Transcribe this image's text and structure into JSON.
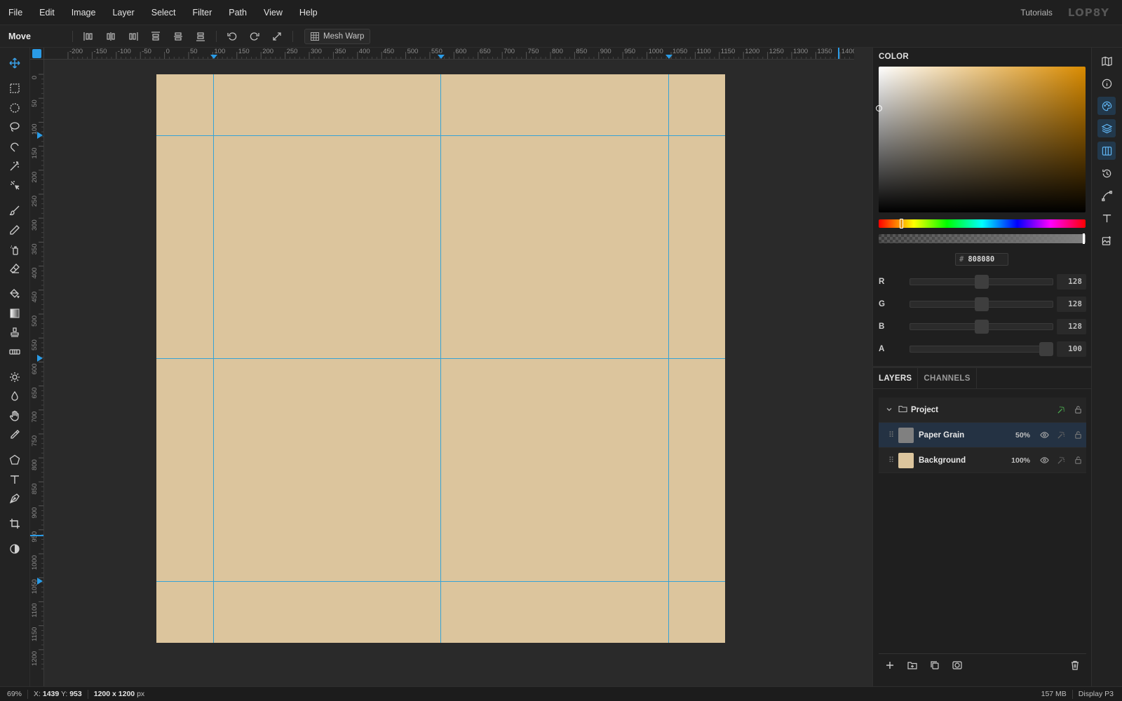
{
  "menu": {
    "items": [
      "File",
      "Edit",
      "Image",
      "Layer",
      "Select",
      "Filter",
      "Path",
      "View",
      "Help"
    ],
    "tutorials": "Tutorials",
    "logo": "LOP8Y"
  },
  "options_bar": {
    "tool_name": "Move",
    "mesh_warp_label": "Mesh Warp"
  },
  "toolbar": {
    "tools": [
      "move-icon",
      "rect-select-icon",
      "ellipse-select-icon",
      "lasso-icon",
      "magnetic-lasso-icon",
      "magic-wand-icon",
      "quick-select-icon",
      "brush-icon",
      "pencil-icon",
      "spray-icon",
      "eraser-icon",
      "fill-bucket-icon",
      "gradient-icon",
      "stamp-icon",
      "healing-icon",
      "dodge-icon",
      "blur-icon",
      "hand-icon",
      "eyedropper-icon",
      "polygon-icon",
      "text-icon",
      "pen-icon",
      "crop-icon",
      "contrast-icon"
    ],
    "active_tool": "move-icon"
  },
  "rulers": {
    "h_labels": [
      "-200",
      "-150",
      "-100",
      "-50",
      "0",
      "50",
      "100",
      "150",
      "200",
      "250",
      "300",
      "350",
      "400",
      "450",
      "500",
      "550",
      "600",
      "650",
      "700",
      "750",
      "800",
      "850",
      "900",
      "950",
      "1000",
      "1050",
      "1100",
      "1150",
      "1200",
      "1250",
      "1300",
      "1350",
      "1400",
      "14"
    ],
    "v_labels": [
      "0",
      "50",
      "100",
      "150",
      "200",
      "250",
      "300",
      "350",
      "400",
      "450",
      "500",
      "550",
      "600",
      "650",
      "700",
      "750",
      "800",
      "850",
      "900",
      "950",
      "1000",
      "1050",
      "1100",
      "1150",
      "1200"
    ]
  },
  "document": {
    "background_color": "#dcc59d",
    "guide_color": "#36a3d6"
  },
  "color_panel": {
    "title": "COLOR",
    "hex": "808080",
    "hue_base": "#d98b00",
    "channels": [
      {
        "label": "R",
        "value": "128",
        "fraction": 0.502
      },
      {
        "label": "G",
        "value": "128",
        "fraction": 0.502
      },
      {
        "label": "B",
        "value": "128",
        "fraction": 0.502
      },
      {
        "label": "A",
        "value": "100",
        "fraction": 1.0
      }
    ]
  },
  "layers_panel": {
    "tabs": [
      "LAYERS",
      "CHANNELS"
    ],
    "group": {
      "name": "Project"
    },
    "layers": [
      {
        "name": "Paper Grain",
        "opacity": "50%",
        "thumb": "#808080",
        "selected": true
      },
      {
        "name": "Background",
        "opacity": "100%",
        "thumb": "#dcc59d",
        "selected": false
      }
    ]
  },
  "icon_rail": [
    "map-icon",
    "info-icon",
    "palette-icon",
    "layers-icon",
    "channels-icon",
    "history-icon",
    "path-icon",
    "text-icon",
    "image-adjust-icon"
  ],
  "status": {
    "zoom": "69%",
    "coords_x_label": "X:",
    "coords_x": "1439",
    "coords_y_label": "Y:",
    "coords_y": "953",
    "doc_size": "1200 x 1200",
    "doc_unit": "px",
    "memory": "157 MB",
    "color_profile": "Display P3"
  }
}
